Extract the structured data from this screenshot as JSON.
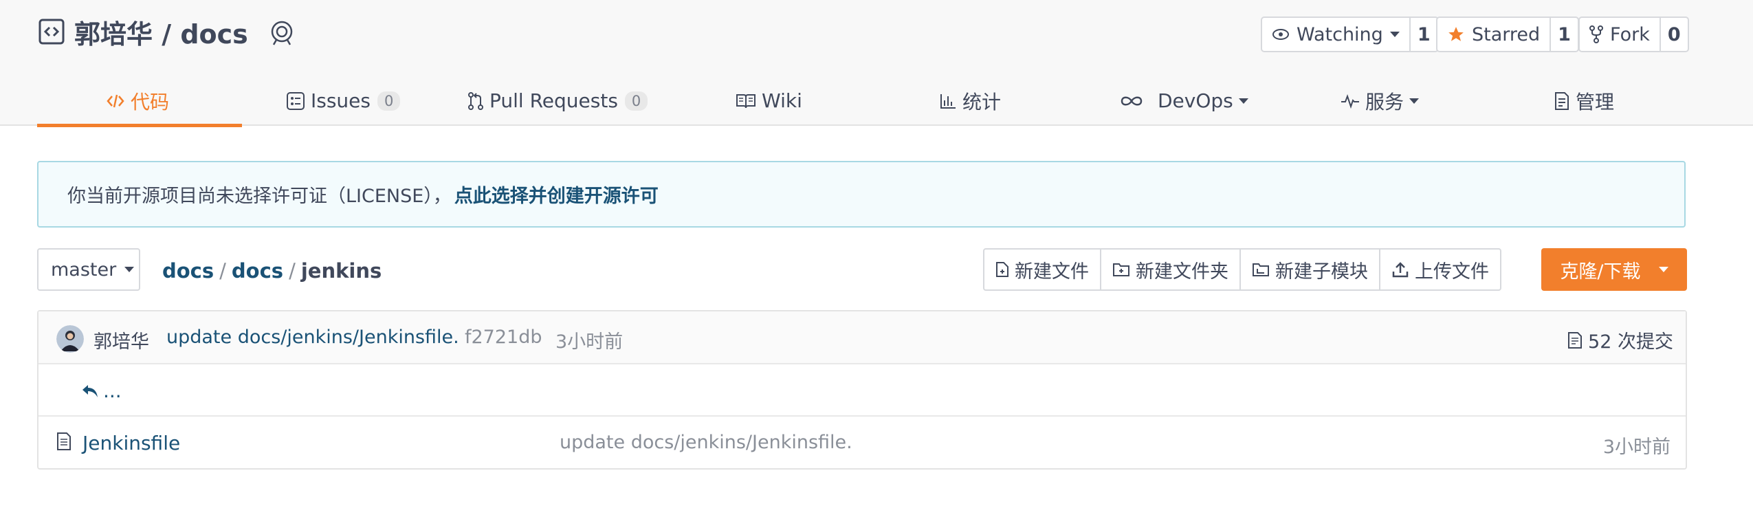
{
  "repo": {
    "title": "郭培华 / docs",
    "icon": "code-repo-icon",
    "badge_icon": "award-icon"
  },
  "actions": {
    "watch": {
      "label": "Watching",
      "count": "1"
    },
    "star": {
      "label": "Starred",
      "count": "1"
    },
    "fork": {
      "label": "Fork",
      "count": "0"
    }
  },
  "tabs": [
    {
      "label": "代码",
      "icon": "code-icon",
      "active": true
    },
    {
      "label": "Issues",
      "badge": "0",
      "icon": "issues-icon"
    },
    {
      "label": "Pull Requests",
      "badge": "0",
      "icon": "pull-request-icon"
    },
    {
      "label": "Wiki",
      "icon": "book-icon"
    },
    {
      "label": "统计",
      "icon": "bar-chart-icon"
    },
    {
      "label": "DevOps",
      "icon": "infinity-icon"
    },
    {
      "label": "服务",
      "icon": "pulse-icon"
    },
    {
      "label": "管理",
      "icon": "document-icon"
    }
  ],
  "license": {
    "text": "你当前开源项目尚未选择许可证（LICENSE），",
    "link": "点此选择并创建开源许可"
  },
  "branch": "master",
  "breadcrumb": {
    "root": "docs",
    "folder": "docs",
    "current": "jenkins",
    "separator": "/"
  },
  "file_buttons": {
    "new_file": "新建文件",
    "new_folder": "新建文件夹",
    "new_submodule": "新建子模块",
    "upload": "上传文件"
  },
  "clone_label": "克隆/下载",
  "last_commit": {
    "author": "郭培华",
    "message": "update docs/jenkins/Jenkinsfile.",
    "sha": "f2721db",
    "time": "3小时前",
    "commit_count": "52 次提交"
  },
  "up_link": "...",
  "files": [
    {
      "name": "Jenkinsfile",
      "message": "update docs/jenkins/Jenkinsfile.",
      "time": "3小时前"
    }
  ],
  "colors": {
    "accent": "#f27f2c",
    "link": "#1a5276",
    "notice_border": "#a7d8e3"
  }
}
